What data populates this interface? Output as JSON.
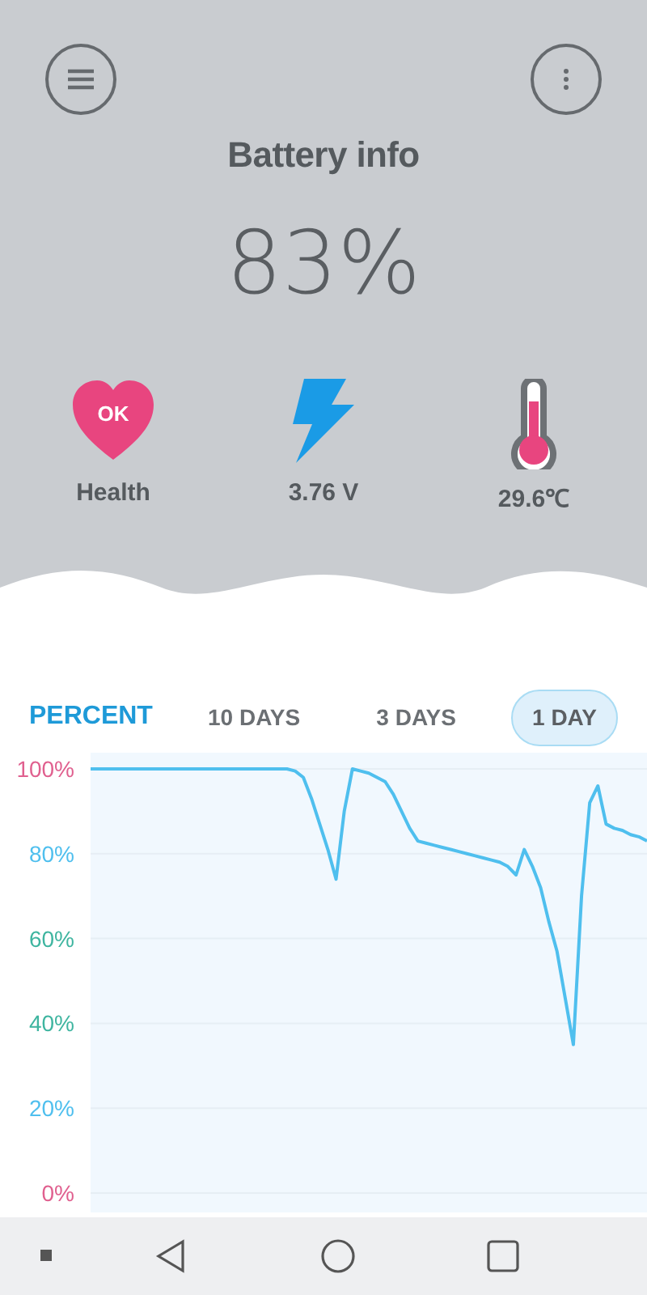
{
  "header": {
    "title": "Battery info",
    "percent": "83%"
  },
  "stats": [
    {
      "kind": "health",
      "badge": "OK",
      "label": "Health"
    },
    {
      "kind": "voltage",
      "label": "3.76 V"
    },
    {
      "kind": "temperature",
      "label": "29.6℃"
    }
  ],
  "metric_label": "PERCENT",
  "tabs": [
    {
      "label": "10 DAYS",
      "selected": false
    },
    {
      "label": "3 DAYS",
      "selected": false
    },
    {
      "label": "1 DAY",
      "selected": true
    }
  ],
  "chart_data": {
    "type": "line",
    "ylim": [
      0,
      100
    ],
    "grid": true,
    "yticks": [
      {
        "value": 100,
        "label": "100%"
      },
      {
        "value": 80,
        "label": "80%"
      },
      {
        "value": 60,
        "label": "60%"
      },
      {
        "value": 40,
        "label": "40%"
      },
      {
        "value": 20,
        "label": "20%"
      },
      {
        "value": 0,
        "label": "0%"
      }
    ],
    "categories": [
      null,
      null,
      null,
      null,
      null,
      null,
      null,
      null,
      null,
      null,
      null,
      null,
      null,
      null,
      null,
      null,
      null,
      null,
      null,
      null,
      null,
      null,
      null,
      null,
      null,
      null,
      null,
      null,
      null,
      null,
      null,
      null,
      null,
      null,
      null,
      null,
      null,
      null,
      null,
      null,
      null,
      null,
      null,
      null,
      null,
      null,
      null,
      null,
      null,
      null,
      null,
      null,
      null,
      null,
      null,
      null,
      null,
      null,
      null,
      null,
      null,
      null,
      null,
      null,
      null,
      null,
      null,
      null,
      null
    ],
    "series": [
      {
        "color": "#4fbfee",
        "values": [
          100,
          100,
          100,
          100,
          100,
          100,
          100,
          100,
          100,
          100,
          100,
          100,
          100,
          100,
          100,
          100,
          100,
          100,
          100,
          100,
          100,
          100,
          100,
          100,
          100,
          99.5,
          98,
          93,
          87,
          81,
          74,
          90,
          100,
          99.5,
          99,
          98,
          97,
          94,
          90,
          86,
          83,
          82.5,
          82,
          81.5,
          81,
          80.5,
          80,
          79.5,
          79,
          78.5,
          78,
          77,
          75,
          81,
          77,
          72,
          64,
          57,
          46,
          35,
          70,
          92,
          96,
          87,
          86,
          85.5,
          84.5,
          84,
          83
        ]
      }
    ]
  }
}
